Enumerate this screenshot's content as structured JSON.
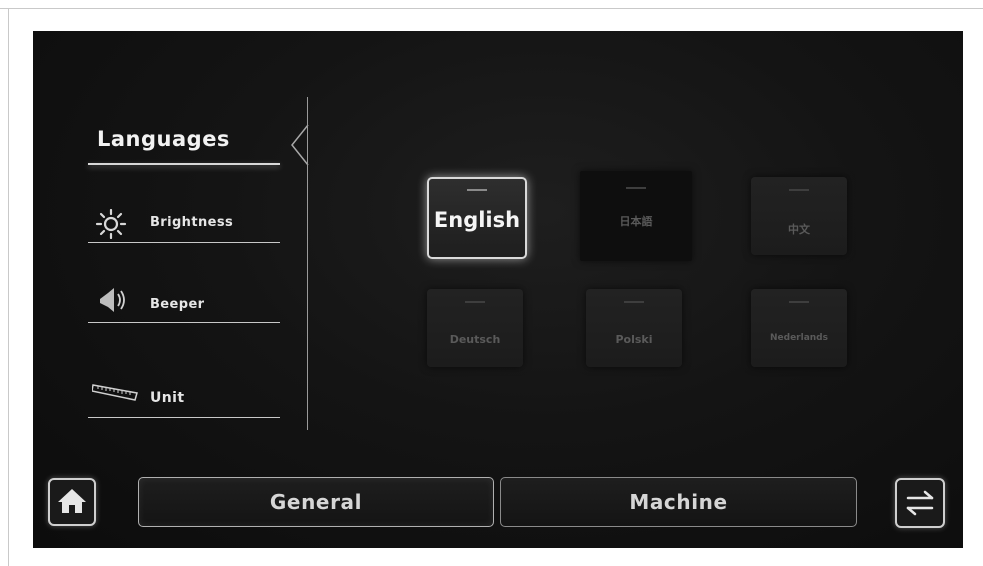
{
  "sidebar": {
    "languages_label": "Languages",
    "brightness_label": "Brightness",
    "beeper_label": "Beeper",
    "unit_label": "Unit"
  },
  "languages": [
    {
      "label": "English",
      "selected": true
    },
    {
      "label": "日本語",
      "selected": false
    },
    {
      "label": "中文",
      "selected": false
    },
    {
      "label": "Deutsch",
      "selected": false
    },
    {
      "label": "Polski",
      "selected": false
    },
    {
      "label": "Nederlands",
      "selected": false
    }
  ],
  "bottom_bar": {
    "home_icon": "home-icon",
    "swap_icon": "swap-arrows-icon",
    "tabs": [
      {
        "label": "General",
        "active": true
      },
      {
        "label": "Machine",
        "active": false
      }
    ]
  },
  "colors": {
    "background": "#141414",
    "text_active": "#f5f5f5",
    "text_inactive": "#5a5a5a",
    "accent_border": "#d9d9d9"
  }
}
